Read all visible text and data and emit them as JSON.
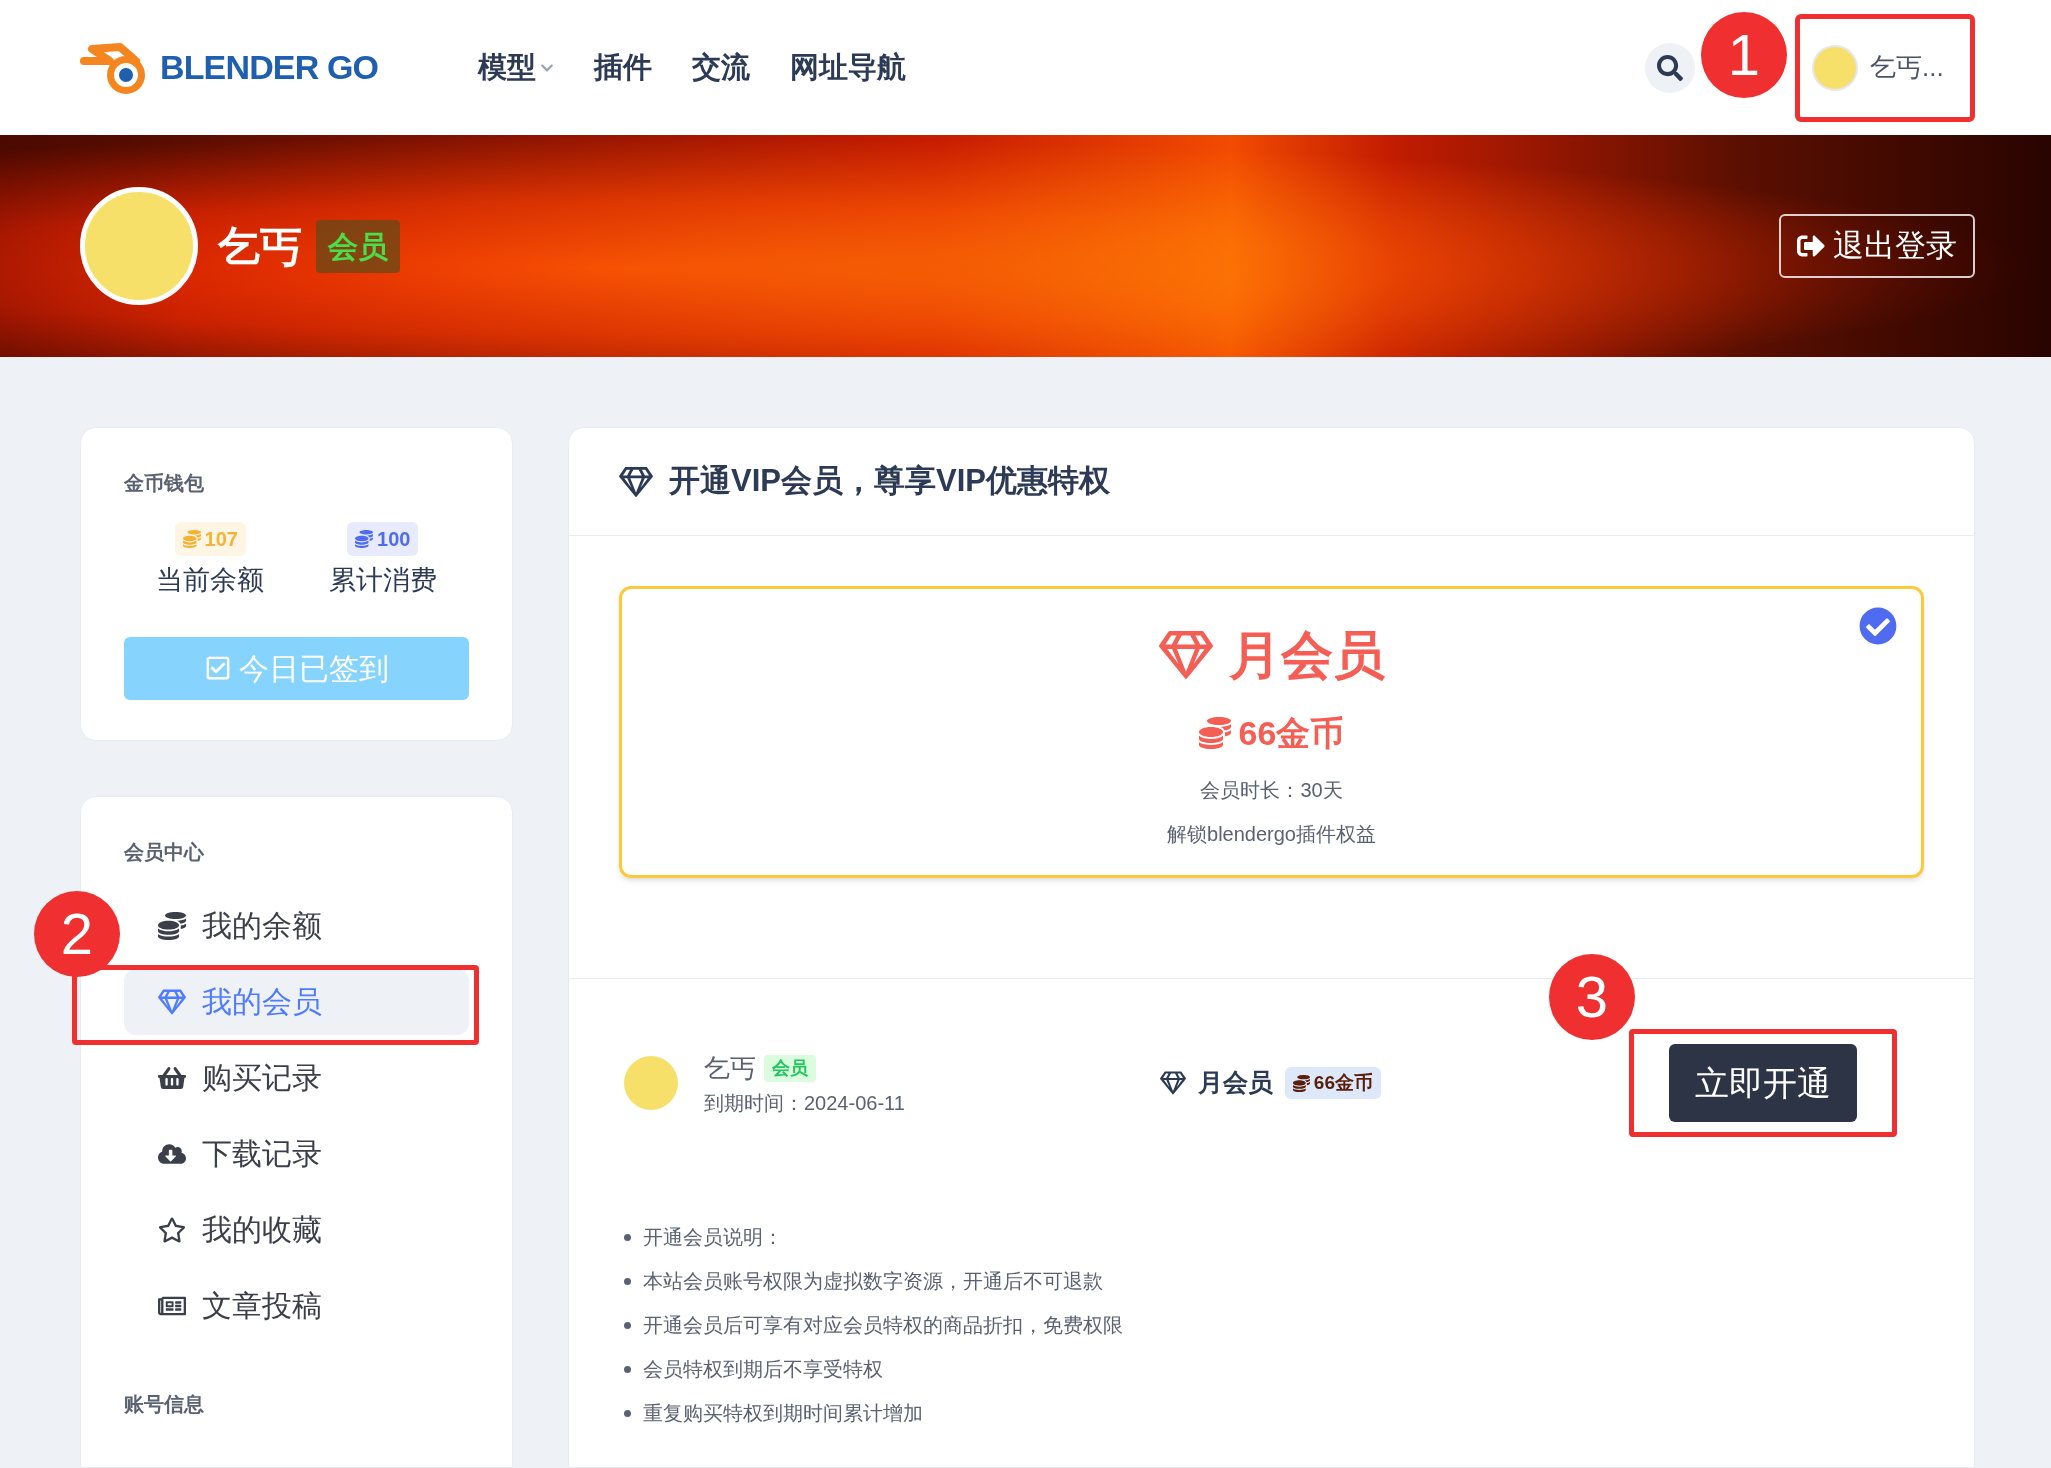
{
  "header": {
    "logo": "BLENDER GO",
    "nav": [
      {
        "label": "模型",
        "dropdown": true
      },
      {
        "label": "插件",
        "dropdown": false
      },
      {
        "label": "交流",
        "dropdown": false
      },
      {
        "label": "网址导航",
        "dropdown": false
      }
    ],
    "user_name": "乞丐..."
  },
  "profile": {
    "name": "乞丐",
    "badge": "会员",
    "logout": "退出登录"
  },
  "wallet": {
    "title": "金币钱包",
    "stats": [
      {
        "value": "107",
        "label": "当前余额",
        "color": "#f5b335"
      },
      {
        "value": "100",
        "label": "累计消费",
        "color": "#4f6bf0"
      }
    ],
    "checkin": {
      "label": "今日已签到",
      "disabled": true
    }
  },
  "member_center": {
    "title": "会员中心",
    "items": [
      {
        "label": "我的余额",
        "kind": "coins",
        "selected": false
      },
      {
        "label": "我的会员",
        "kind": "gem",
        "selected": true
      },
      {
        "label": "购买记录",
        "kind": "basket",
        "selected": false
      },
      {
        "label": "下载记录",
        "kind": "cloud",
        "selected": false
      },
      {
        "label": "我的收藏",
        "kind": "star",
        "selected": false
      },
      {
        "label": "文章投稿",
        "kind": "news",
        "selected": false
      }
    ]
  },
  "account_title": "账号信息",
  "vip": {
    "title": "开通VIP会员，尊享VIP优惠特权",
    "plans": [
      {
        "name": "月会员",
        "price": "66金币",
        "duration": "会员时长：30天",
        "desc": "解锁blendergo插件权益",
        "selected": true
      }
    ],
    "summary": {
      "user": "乞丐",
      "badge": "会员",
      "expiry": "到期时间：2024-06-11",
      "plan": "月会员",
      "price": "66金币",
      "button": "立即开通"
    },
    "notes": [
      "开通会员说明：",
      "本站会员账号权限为虚拟数字资源，开通后不可退款",
      "开通会员后可享有对应会员特权的商品折扣，免费权限",
      "会员特权到期后不享受特权",
      "重复购买特权到期时间累计增加"
    ]
  },
  "annotations": [
    "1",
    "2",
    "3"
  ]
}
